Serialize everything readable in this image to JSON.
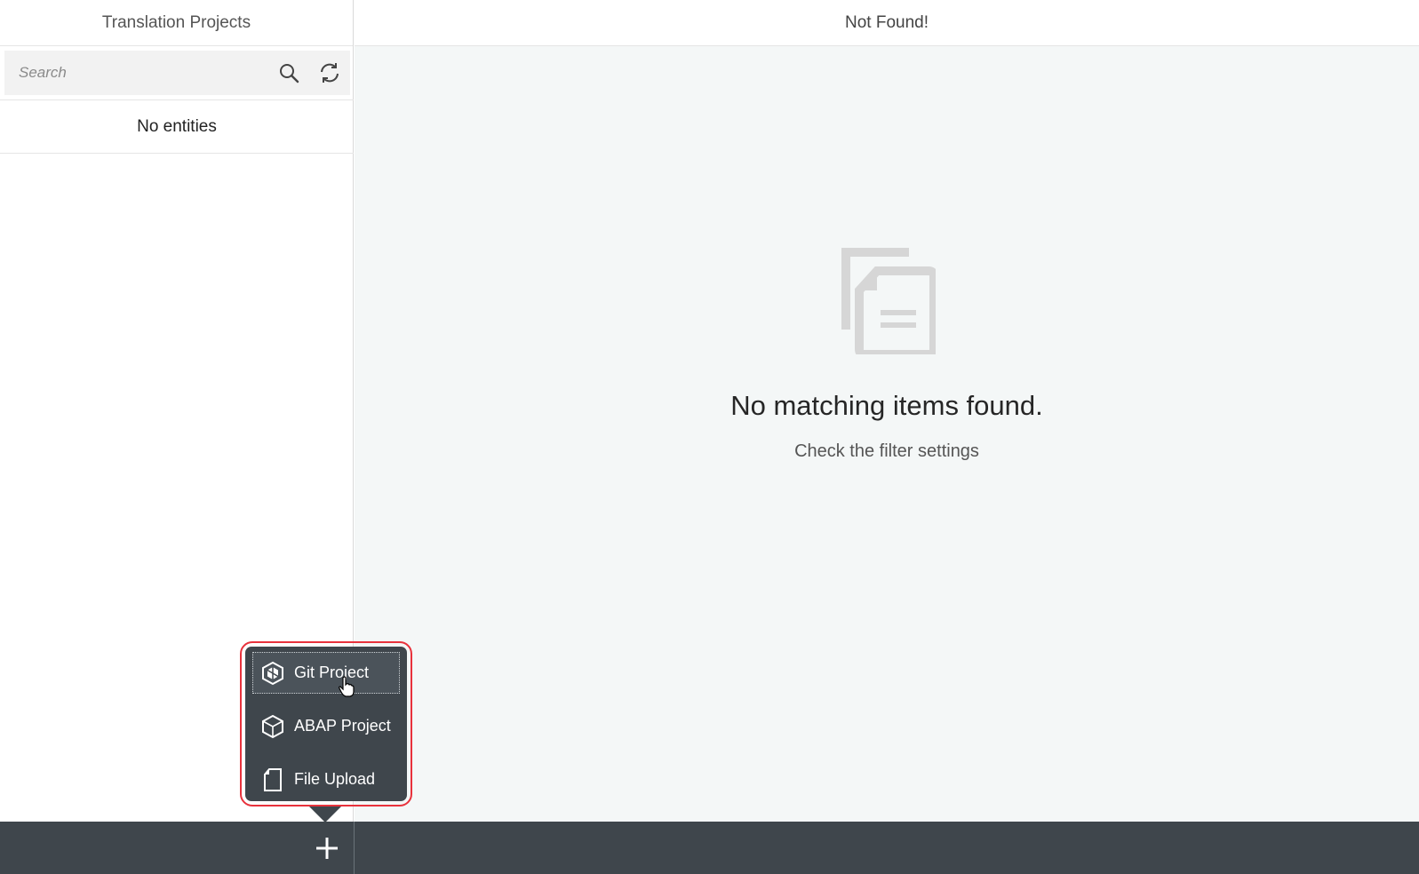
{
  "master": {
    "title": "Translation Projects",
    "search_placeholder": "Search",
    "empty_list_text": "No entities"
  },
  "detail": {
    "title": "Not Found!",
    "empty_title": "No matching items found.",
    "empty_subtitle": "Check the filter settings"
  },
  "menu": {
    "items": [
      {
        "label": "Git Project",
        "icon": "git-project-icon"
      },
      {
        "label": "ABAP Project",
        "icon": "abap-project-icon"
      },
      {
        "label": "File Upload",
        "icon": "file-icon"
      }
    ]
  },
  "colors": {
    "footer_bg": "#3f464c",
    "highlight_border": "#e8323c",
    "detail_bg": "#f4f7f7"
  }
}
